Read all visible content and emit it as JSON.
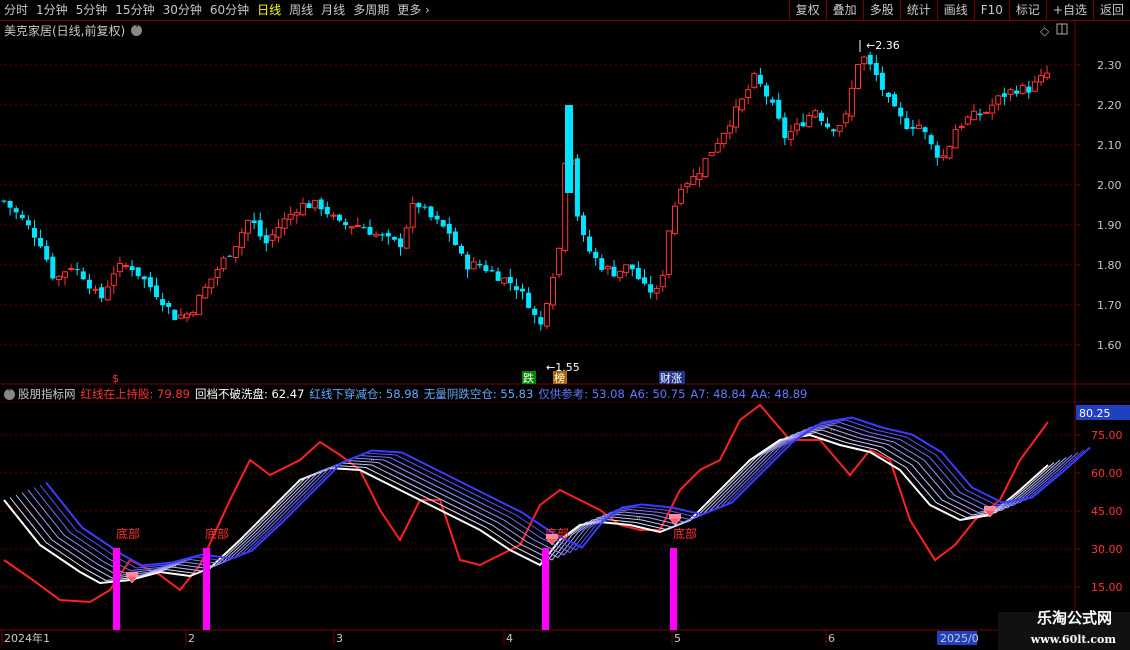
{
  "toolbar": {
    "tabs": [
      "分时",
      "1分钟",
      "5分钟",
      "15分钟",
      "30分钟",
      "60分钟",
      "日线",
      "周线",
      "月线",
      "多周期",
      "更多"
    ],
    "active_tab": "日线",
    "actions": [
      "复权",
      "叠加",
      "多股",
      "统计",
      "画线",
      "F10",
      "标记",
      "+自选",
      "返回"
    ]
  },
  "stock": {
    "title": "美克家居(日线,前复权)"
  },
  "price_axis": {
    "ticks": [
      "2.30",
      "2.20",
      "2.10",
      "2.00",
      "1.90",
      "1.80",
      "1.70",
      "1.60"
    ]
  },
  "annotations": {
    "high_label": "2.36",
    "low_label": "1.55",
    "tag_die": "跌",
    "tag_bang": "榜",
    "tag_caizhang": "财涨",
    "dollar": "$"
  },
  "indicator": {
    "name": "股朋指标网",
    "items": [
      {
        "label": "红线在上持股:",
        "value": "79.89",
        "color": "#ff3333"
      },
      {
        "label": "回档不破洗盘:",
        "value": "62.47",
        "color": "#ffffff"
      },
      {
        "label": "红线下穿减仓:",
        "value": "58.98",
        "color": "#66aaff"
      },
      {
        "label": "无量阴跌空仓:",
        "value": "55.83",
        "color": "#66aaff"
      },
      {
        "label": "仅供参考:",
        "value": "53.08",
        "color": "#6677ff"
      },
      {
        "label": "A6:",
        "value": "50.75",
        "color": "#6677ff"
      },
      {
        "label": "A7:",
        "value": "48.84",
        "color": "#6677ff"
      },
      {
        "label": "AA:",
        "value": "48.89",
        "color": "#6677ff"
      }
    ],
    "axis_ticks": [
      "75.00",
      "60.00",
      "45.00",
      "30.00",
      "15.00"
    ],
    "current_value": "80.25",
    "bottom_labels": [
      "底部",
      "底部",
      "底部",
      "底部"
    ]
  },
  "time_axis": {
    "labels": [
      "2024年1",
      "2",
      "3",
      "4",
      "5",
      "6",
      "2025/0"
    ]
  },
  "colors": {
    "up": "#ff3333",
    "down": "#00e5ff",
    "grid": "#7a0000",
    "magenta": "#ff00ff"
  },
  "watermark": {
    "line1": "乐淘公式网",
    "line2": "www.60lt.com"
  }
}
